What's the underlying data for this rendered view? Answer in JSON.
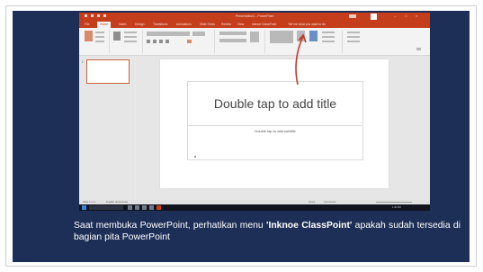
{
  "powerpoint": {
    "window_title": "Presentation1 - PowerPoint",
    "tabs": [
      {
        "label": "File"
      },
      {
        "label": "Home"
      },
      {
        "label": "Insert"
      },
      {
        "label": "Design"
      },
      {
        "label": "Transitions"
      },
      {
        "label": "Animations"
      },
      {
        "label": "Slide Show"
      },
      {
        "label": "Review"
      },
      {
        "label": "View"
      },
      {
        "label": "Inknoe ClassPoint"
      },
      {
        "label": "Tell me what you want to do"
      }
    ],
    "active_tab": "Home",
    "thumbnail_number": "1",
    "slide": {
      "title_placeholder": "Double tap to add title",
      "subtitle_placeholder": "Double tap to add subtitle"
    },
    "statusbar": {
      "slide_info": "Slide 1 of 1",
      "language": "English (Indonesia)",
      "notes": "Notes",
      "comments": "Comments"
    },
    "taskbar": {
      "clock": "1:30 PM"
    }
  },
  "annotation": {
    "arrow_color": "#c0392b"
  },
  "caption": {
    "part1": "Saat membuka PowerPoint, perhatikan menu ",
    "highlight": "'Inknoe ClassPoint'",
    "part2": " apakah sudah tersedia di bagian pita PowerPoint"
  },
  "colors": {
    "background": "#1d2f57",
    "ppt_accent": "#c43e1c",
    "caption_text": "#ffffff"
  }
}
